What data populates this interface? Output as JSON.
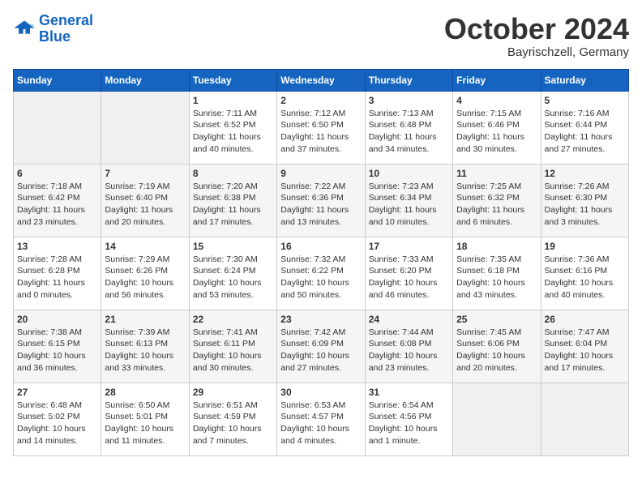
{
  "header": {
    "logo_line1": "General",
    "logo_line2": "Blue",
    "month": "October 2024",
    "location": "Bayrischzell, Germany"
  },
  "weekdays": [
    "Sunday",
    "Monday",
    "Tuesday",
    "Wednesday",
    "Thursday",
    "Friday",
    "Saturday"
  ],
  "weeks": [
    [
      {
        "day": "",
        "detail": ""
      },
      {
        "day": "",
        "detail": ""
      },
      {
        "day": "1",
        "detail": "Sunrise: 7:11 AM\nSunset: 6:52 PM\nDaylight: 11 hours and 40 minutes."
      },
      {
        "day": "2",
        "detail": "Sunrise: 7:12 AM\nSunset: 6:50 PM\nDaylight: 11 hours and 37 minutes."
      },
      {
        "day": "3",
        "detail": "Sunrise: 7:13 AM\nSunset: 6:48 PM\nDaylight: 11 hours and 34 minutes."
      },
      {
        "day": "4",
        "detail": "Sunrise: 7:15 AM\nSunset: 6:46 PM\nDaylight: 11 hours and 30 minutes."
      },
      {
        "day": "5",
        "detail": "Sunrise: 7:16 AM\nSunset: 6:44 PM\nDaylight: 11 hours and 27 minutes."
      }
    ],
    [
      {
        "day": "6",
        "detail": "Sunrise: 7:18 AM\nSunset: 6:42 PM\nDaylight: 11 hours and 23 minutes."
      },
      {
        "day": "7",
        "detail": "Sunrise: 7:19 AM\nSunset: 6:40 PM\nDaylight: 11 hours and 20 minutes."
      },
      {
        "day": "8",
        "detail": "Sunrise: 7:20 AM\nSunset: 6:38 PM\nDaylight: 11 hours and 17 minutes."
      },
      {
        "day": "9",
        "detail": "Sunrise: 7:22 AM\nSunset: 6:36 PM\nDaylight: 11 hours and 13 minutes."
      },
      {
        "day": "10",
        "detail": "Sunrise: 7:23 AM\nSunset: 6:34 PM\nDaylight: 11 hours and 10 minutes."
      },
      {
        "day": "11",
        "detail": "Sunrise: 7:25 AM\nSunset: 6:32 PM\nDaylight: 11 hours and 6 minutes."
      },
      {
        "day": "12",
        "detail": "Sunrise: 7:26 AM\nSunset: 6:30 PM\nDaylight: 11 hours and 3 minutes."
      }
    ],
    [
      {
        "day": "13",
        "detail": "Sunrise: 7:28 AM\nSunset: 6:28 PM\nDaylight: 11 hours and 0 minutes."
      },
      {
        "day": "14",
        "detail": "Sunrise: 7:29 AM\nSunset: 6:26 PM\nDaylight: 10 hours and 56 minutes."
      },
      {
        "day": "15",
        "detail": "Sunrise: 7:30 AM\nSunset: 6:24 PM\nDaylight: 10 hours and 53 minutes."
      },
      {
        "day": "16",
        "detail": "Sunrise: 7:32 AM\nSunset: 6:22 PM\nDaylight: 10 hours and 50 minutes."
      },
      {
        "day": "17",
        "detail": "Sunrise: 7:33 AM\nSunset: 6:20 PM\nDaylight: 10 hours and 46 minutes."
      },
      {
        "day": "18",
        "detail": "Sunrise: 7:35 AM\nSunset: 6:18 PM\nDaylight: 10 hours and 43 minutes."
      },
      {
        "day": "19",
        "detail": "Sunrise: 7:36 AM\nSunset: 6:16 PM\nDaylight: 10 hours and 40 minutes."
      }
    ],
    [
      {
        "day": "20",
        "detail": "Sunrise: 7:38 AM\nSunset: 6:15 PM\nDaylight: 10 hours and 36 minutes."
      },
      {
        "day": "21",
        "detail": "Sunrise: 7:39 AM\nSunset: 6:13 PM\nDaylight: 10 hours and 33 minutes."
      },
      {
        "day": "22",
        "detail": "Sunrise: 7:41 AM\nSunset: 6:11 PM\nDaylight: 10 hours and 30 minutes."
      },
      {
        "day": "23",
        "detail": "Sunrise: 7:42 AM\nSunset: 6:09 PM\nDaylight: 10 hours and 27 minutes."
      },
      {
        "day": "24",
        "detail": "Sunrise: 7:44 AM\nSunset: 6:08 PM\nDaylight: 10 hours and 23 minutes."
      },
      {
        "day": "25",
        "detail": "Sunrise: 7:45 AM\nSunset: 6:06 PM\nDaylight: 10 hours and 20 minutes."
      },
      {
        "day": "26",
        "detail": "Sunrise: 7:47 AM\nSunset: 6:04 PM\nDaylight: 10 hours and 17 minutes."
      }
    ],
    [
      {
        "day": "27",
        "detail": "Sunrise: 6:48 AM\nSunset: 5:02 PM\nDaylight: 10 hours and 14 minutes."
      },
      {
        "day": "28",
        "detail": "Sunrise: 6:50 AM\nSunset: 5:01 PM\nDaylight: 10 hours and 11 minutes."
      },
      {
        "day": "29",
        "detail": "Sunrise: 6:51 AM\nSunset: 4:59 PM\nDaylight: 10 hours and 7 minutes."
      },
      {
        "day": "30",
        "detail": "Sunrise: 6:53 AM\nSunset: 4:57 PM\nDaylight: 10 hours and 4 minutes."
      },
      {
        "day": "31",
        "detail": "Sunrise: 6:54 AM\nSunset: 4:56 PM\nDaylight: 10 hours and 1 minute."
      },
      {
        "day": "",
        "detail": ""
      },
      {
        "day": "",
        "detail": ""
      }
    ]
  ]
}
